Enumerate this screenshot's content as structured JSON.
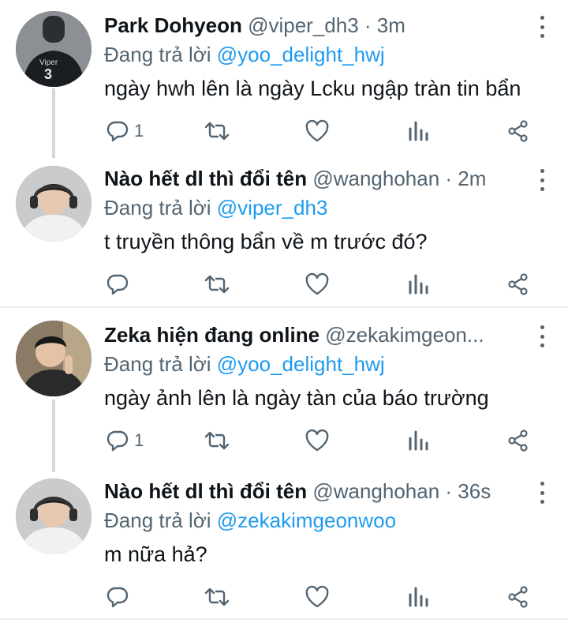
{
  "colors": {
    "link": "#1d9bf0",
    "muted": "#536471",
    "text": "#0f1419",
    "divider": "#e6ecf0"
  },
  "tweets": [
    {
      "name": "Park Dohyeon",
      "handle": "@viper_dh3 · 3m",
      "reply_prefix": "Đang trả lời ",
      "reply_to": "@yoo_delight_hwj",
      "text": "ngày hwh lên là ngày Lcku ngập tràn tin bẩn",
      "reply_count": "1",
      "avatar": "avatar-jersey-viper-3"
    },
    {
      "name": "Nào hết dl thì đổi tên",
      "handle": "@wanghohan · 2m",
      "reply_prefix": "Đang trả lời ",
      "reply_to": "@viper_dh3",
      "text": "t truyền thông bẩn về m trước đó?",
      "reply_count": "",
      "avatar": "avatar-headset-player"
    },
    {
      "name": "Zeka hiện đang online",
      "handle": "@zekakimgeon...",
      "reply_prefix": "Đang trả lời ",
      "reply_to": "@yoo_delight_hwj",
      "text": "ngày ảnh lên là ngày tàn của báo trường",
      "reply_count": "1",
      "avatar": "avatar-zeka-photo"
    },
    {
      "name": "Nào hết dl thì đổi tên",
      "handle": "@wanghohan · 36s",
      "reply_prefix": "Đang trả lời ",
      "reply_to": "@zekakimgeonwoo",
      "text": "m nữa hả?",
      "reply_count": "",
      "avatar": "avatar-headset-player"
    }
  ],
  "icons": [
    "reply-icon",
    "retweet-icon",
    "like-icon",
    "analytics-icon",
    "share-icon",
    "more-icon"
  ]
}
